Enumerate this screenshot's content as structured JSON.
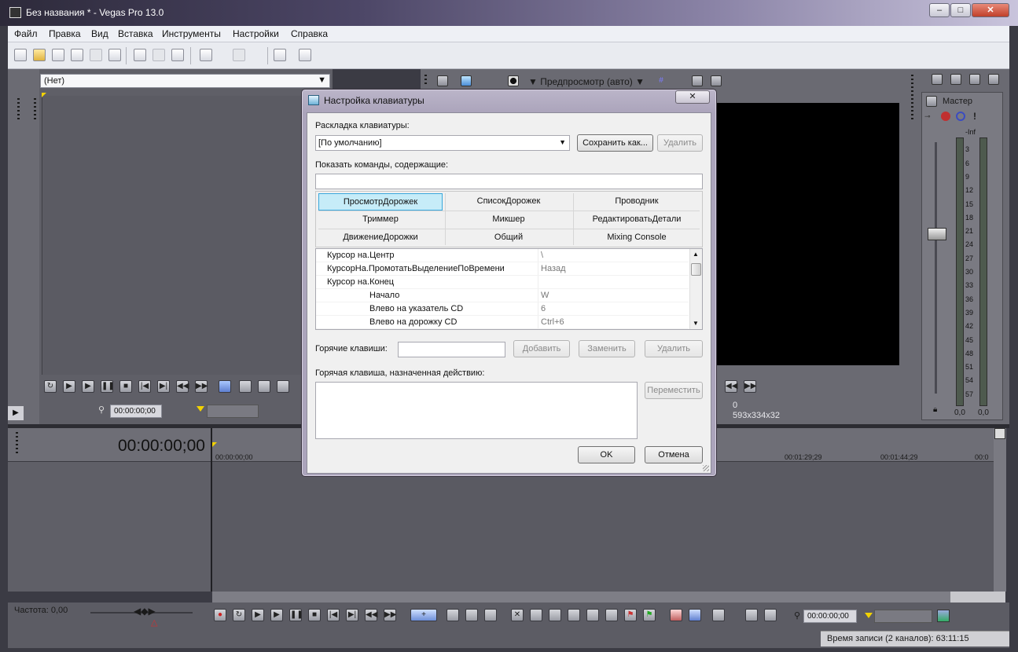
{
  "window": {
    "title": "Без названия * - Vegas Pro 13.0",
    "minimize": "–",
    "maximize": "□",
    "close": "✕"
  },
  "menu": [
    "Файл",
    "Правка",
    "Вид",
    "Вставка",
    "Инструменты",
    "Настройки",
    "Справка"
  ],
  "left_pane": {
    "combo_value": "(Нет)",
    "timecode": "00:00:00;00"
  },
  "preview": {
    "mode_label": "Предпросмотр (авто)",
    "frame_number": "0",
    "frame_size": "593x334x32"
  },
  "master": {
    "label": "Мастер",
    "scale": [
      "-Inf",
      "3",
      "6",
      "9",
      "12",
      "15",
      "18",
      "21",
      "24",
      "27",
      "30",
      "33",
      "36",
      "39",
      "42",
      "45",
      "48",
      "51",
      "54",
      "57"
    ],
    "left_value": "0,0",
    "right_value": "0,0"
  },
  "timeline": {
    "timecode": "00:00:00;00",
    "ruler": [
      "00:00:00;00",
      "00:01:29;29",
      "00:01:44;29",
      "00:0"
    ],
    "rate": "Частота: 0,00",
    "bottom_timecode": "00:00:00;00",
    "status": "Время записи (2 каналов): 63:11:15"
  },
  "dialog": {
    "title": "Настройка клавиатуры",
    "close": "✕",
    "layout_label": "Раскладка клавиатуры:",
    "layout_value": "[По умолчанию]",
    "save_as": "Сохранить как...",
    "delete_layout": "Удалить",
    "filter_label": "Показать команды, содержащие:",
    "filter_value": "",
    "contexts": [
      "ПросмотрДорожек",
      "СписокДорожек",
      "Проводник",
      "Триммер",
      "Микшер",
      "РедактироватьДетали",
      "ДвижениеДорожки",
      "Общий",
      "Mixing Console"
    ],
    "commands": [
      {
        "name": "Курсор на.Центр",
        "key": "\\",
        "indent": false
      },
      {
        "name": "КурсорНа.ПромотатьВыделениеПоВремени",
        "key": "Назад",
        "indent": false
      },
      {
        "name": "Курсор на.Конец",
        "key": "",
        "indent": false
      },
      {
        "name": "Начало",
        "key": "W",
        "indent": true
      },
      {
        "name": "Влево на указатель CD",
        "key": "6",
        "indent": true
      },
      {
        "name": "Влево на дорожку CD",
        "key": "Ctrl+6",
        "indent": true
      }
    ],
    "hotkey_label": "Горячие клавиши:",
    "hotkey_value": "",
    "add": "Добавить",
    "replace": "Заменить",
    "remove": "Удалить",
    "assigned_label": "Горячая клавиша, назначенная действию:",
    "move": "Переместить",
    "ok": "OK",
    "cancel": "Отмена"
  },
  "colors": {
    "selected_tab": "#c6ecf8",
    "accent": "#3aa8dc"
  }
}
